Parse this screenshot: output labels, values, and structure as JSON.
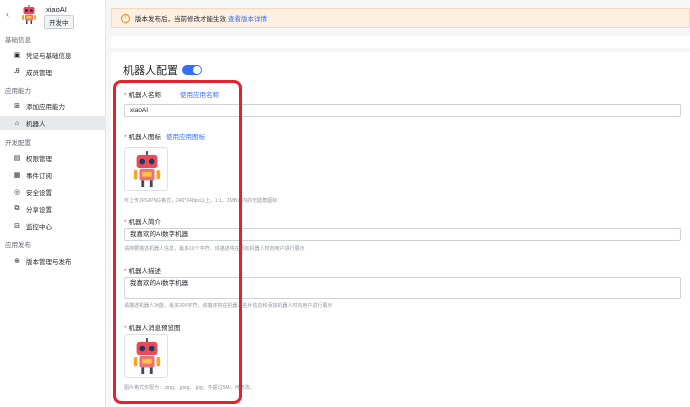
{
  "app": {
    "name": "xiaoAI",
    "badge": "开发中"
  },
  "sidebar": {
    "groups": [
      {
        "label": "基础信息",
        "items": [
          {
            "label": "凭证与基础信息",
            "icon": "credential-icon"
          },
          {
            "label": "成员管理",
            "icon": "person-icon"
          }
        ]
      },
      {
        "label": "应用能力",
        "items": [
          {
            "label": "添加应用能力",
            "icon": "add-icon"
          },
          {
            "label": "机器人",
            "icon": "robot-icon",
            "active": true
          }
        ]
      },
      {
        "label": "开发配置",
        "items": [
          {
            "label": "权限管理",
            "icon": "permission-icon"
          },
          {
            "label": "事件订阅",
            "icon": "event-icon"
          },
          {
            "label": "安全设置",
            "icon": "shield-icon"
          },
          {
            "label": "分享设置",
            "icon": "share-icon"
          },
          {
            "label": "监控中心",
            "icon": "monitor-icon"
          }
        ]
      },
      {
        "label": "应用发布",
        "items": [
          {
            "label": "版本管理与发布",
            "icon": "version-icon"
          }
        ]
      }
    ]
  },
  "notice": {
    "text": "版本发布后，当前修改才能生效",
    "link": "查看版本详情"
  },
  "main": {
    "title": "机器人配置",
    "toggle_on": true,
    "name": {
      "label": "机器人名称",
      "link": "使用应用名称",
      "value": "xiaoAI"
    },
    "icon": {
      "label": "机器人图标",
      "link": "使用应用图标",
      "hint": "可上传JPG/PNG格式，240*240px以上，1:1，2MB以内的无圆角图标"
    },
    "intro": {
      "label": "机器人简介",
      "value": "我喜欢的AI数字机器",
      "hint": "请简要描述机器人信息，最多10个字符，该描述将在添加机器人时向用户进行展示"
    },
    "desc": {
      "label": "机器人描述",
      "value": "我喜欢的AI数字机器",
      "hint": "请描述机器人功能，最多200字符，该描述将在机器人名片信息和添加机器人时向用户进行展示"
    },
    "preview": {
      "label": "机器人消息预览图",
      "hint": "图片格式仅限为：.png、.jpeg、.jpg，不超过5M，可修改。"
    }
  },
  "colors": {
    "accent": "#3370ff",
    "highlight": "#e8202b",
    "required": "#f54a45"
  }
}
